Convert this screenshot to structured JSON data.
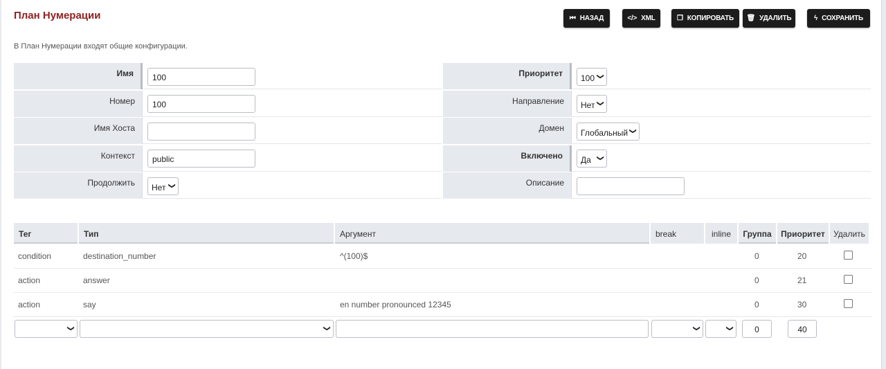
{
  "page": {
    "title": "План Нумерации",
    "description": "В План Нумерации входят общие конфигурации."
  },
  "toolbar": {
    "back_label": "НАЗАД",
    "xml_label": "XML",
    "copy_label": "КОПИРОВАТЬ",
    "delete_label": "УДАЛИТЬ",
    "save_label": "СОХРАНИТЬ"
  },
  "form": {
    "name_label": "Имя",
    "name_value": "100",
    "number_label": "Номер",
    "number_value": "100",
    "hostname_label": "Имя Хоста",
    "hostname_value": "",
    "context_label": "Контекст",
    "context_value": "public",
    "continue_label": "Продолжить",
    "continue_value": "Нет",
    "priority_label": "Приоритет",
    "priority_value": "100",
    "direction_label": "Направление",
    "direction_value": "Нет",
    "domain_label": "Домен",
    "domain_value": "Глобальный",
    "enabled_label": "Включено",
    "enabled_value": "Да",
    "description_label": "Описание",
    "description_value": ""
  },
  "details": {
    "headers": {
      "tag": "Тег",
      "type": "Тип",
      "argument": "Аргумент",
      "break": "break",
      "inline": "inline",
      "group": "Группа",
      "priority": "Приоритет",
      "delete": "Удалить"
    },
    "rows": [
      {
        "tag": "condition",
        "type": "destination_number",
        "argument": "^(100)$",
        "group": "0",
        "priority": "20"
      },
      {
        "tag": "action",
        "type": "answer",
        "argument": "",
        "group": "0",
        "priority": "21"
      },
      {
        "tag": "action",
        "type": "say",
        "argument": "en number pronounced 12345",
        "group": "0",
        "priority": "30"
      }
    ],
    "new_row": {
      "tag": "",
      "type": "",
      "argument": "",
      "break": "",
      "inline": "",
      "group": "0",
      "priority": "40"
    }
  }
}
